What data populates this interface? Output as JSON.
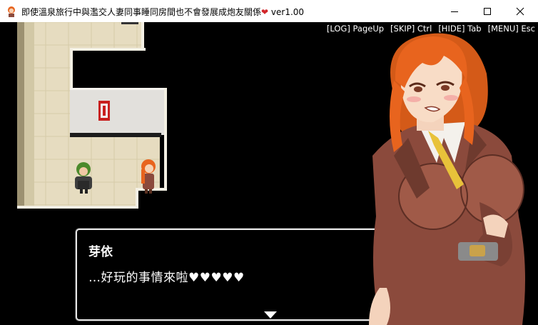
{
  "window": {
    "title": "即使溫泉旅行中與濫交人妻同事睡同房間也不會發展成炮友關係",
    "title_heart": "❤",
    "version": "ver1.00",
    "minimize_icon": "minimize-icon",
    "maximize_icon": "maximize-icon",
    "close_icon": "close-icon"
  },
  "hud": {
    "log": "[LOG] PageUp",
    "skip": "[SKIP] Ctrl",
    "hide": "[HIDE] Tab",
    "menu": "[MENU] Esc"
  },
  "dialogue": {
    "speaker": "芽依",
    "text": "…好玩的事情來啦♥♥♥♥♥",
    "advance_icon": "triangle-down-icon"
  },
  "colors": {
    "accent_heart": "#d2262a",
    "floor": "#e6dcc0",
    "wall": "#e2e0dc",
    "hair": "#e8641e",
    "suit": "#8b4a3c"
  }
}
